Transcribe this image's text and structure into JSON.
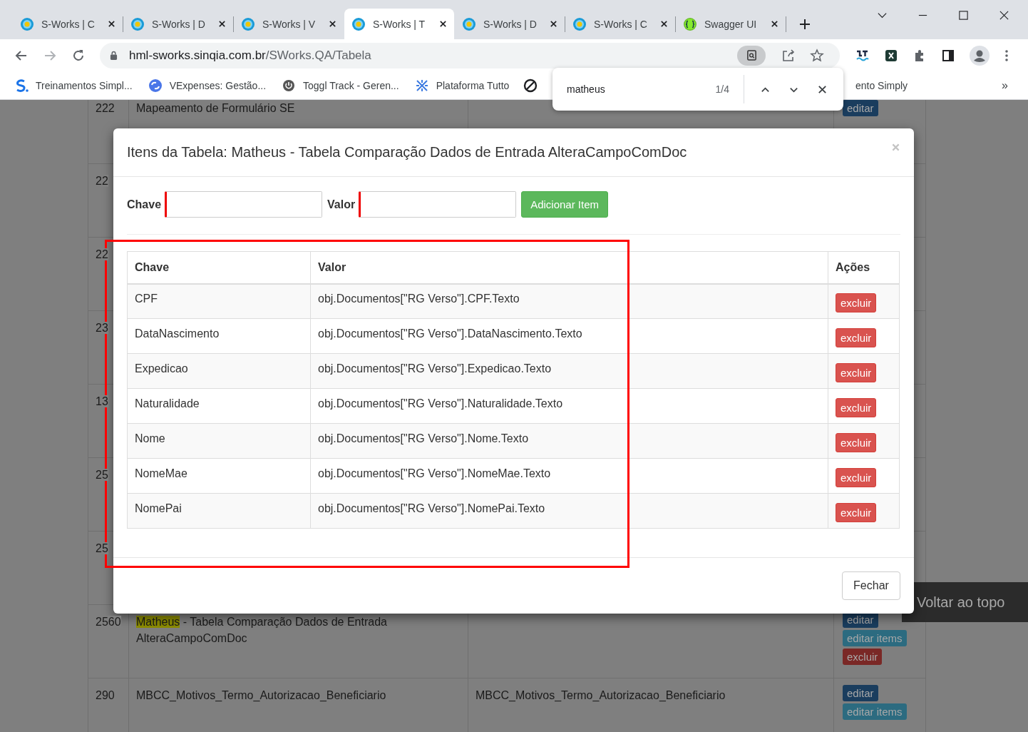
{
  "browser": {
    "tabs": [
      {
        "title": "S-Works | C",
        "kind": "sworks",
        "selected": false
      },
      {
        "title": "S-Works | D",
        "kind": "sworks",
        "selected": false
      },
      {
        "title": "S-Works | V",
        "kind": "sworks",
        "selected": false
      },
      {
        "title": "S-Works | T",
        "kind": "sworks",
        "selected": true
      },
      {
        "title": "S-Works | D",
        "kind": "sworks",
        "selected": false
      },
      {
        "title": "S-Works | C",
        "kind": "sworks",
        "selected": false
      },
      {
        "title": "Swagger UI",
        "kind": "swagger",
        "selected": false
      }
    ],
    "address": {
      "host": "hml-sworks.sinqia.com.br",
      "path": "/SWorks.QA/Tabela"
    },
    "bookmarks": [
      {
        "title": "Treinamentos Simpl...",
        "kind": "logo"
      },
      {
        "title": "VExpenses: Gestão...",
        "kind": "sync"
      },
      {
        "title": "Toggl Track - Geren...",
        "kind": "power"
      },
      {
        "title": "Plataforma Tutto",
        "kind": "cross"
      }
    ],
    "bookmark_partial": "ento Simply",
    "bookmarks_more": "»",
    "find_bar": {
      "query": "matheus",
      "count": "1/4"
    }
  },
  "page": {
    "rows": [
      {
        "id": "222",
        "name": "Mapeamento de Formulário SE",
        "actions": [
          {
            "label": "editar",
            "kind": "edit"
          }
        ]
      },
      {
        "id": "22"
      },
      {
        "id": "22"
      },
      {
        "id": "23"
      },
      {
        "id": "13"
      },
      {
        "id": "25"
      },
      {
        "id": "25"
      },
      {
        "id": "2560",
        "match": "Matheus",
        "name": " - Tabela Comparação Dados de Entrada AlteraCampoComDoc",
        "actions": [
          {
            "label": "editar",
            "kind": "edit"
          },
          {
            "label": "editar items",
            "kind": "items"
          },
          {
            "label": "excluir",
            "kind": "delete"
          }
        ]
      },
      {
        "id": "290",
        "name": "MBCC_Motivos_Termo_Autorizacao_Beneficiario",
        "description": "MBCC_Motivos_Termo_Autorizacao_Beneficiario",
        "actions": [
          {
            "label": "editar",
            "kind": "edit"
          },
          {
            "label": "editar items",
            "kind": "items"
          }
        ]
      }
    ],
    "back_to_top": "Voltar ao topo"
  },
  "modal": {
    "title": "Itens da Tabela: Matheus - Tabela Comparação Dados de Entrada AlteraCampoComDoc",
    "form": {
      "key_label": "Chave",
      "value_label": "Valor",
      "add_button": "Adicionar Item"
    },
    "table": {
      "columns": [
        "Chave",
        "Valor",
        "Ações"
      ],
      "rows": [
        {
          "key": "CPF",
          "value": "obj.Documentos[\"RG Verso\"].CPF.Texto",
          "action": "excluir"
        },
        {
          "key": "DataNascimento",
          "value": "obj.Documentos[\"RG Verso\"].DataNascimento.Texto",
          "action": "excluir"
        },
        {
          "key": "Expedicao",
          "value": "obj.Documentos[\"RG Verso\"].Expedicao.Texto",
          "action": "excluir"
        },
        {
          "key": "Naturalidade",
          "value": "obj.Documentos[\"RG Verso\"].Naturalidade.Texto",
          "action": "excluir"
        },
        {
          "key": "Nome",
          "value": "obj.Documentos[\"RG Verso\"].Nome.Texto",
          "action": "excluir"
        },
        {
          "key": "NomeMae",
          "value": "obj.Documentos[\"RG Verso\"].NomeMae.Texto",
          "action": "excluir"
        },
        {
          "key": "NomePai",
          "value": "obj.Documentos[\"RG Verso\"].NomePai.Texto",
          "action": "excluir"
        }
      ]
    },
    "close_button": "Fechar"
  }
}
